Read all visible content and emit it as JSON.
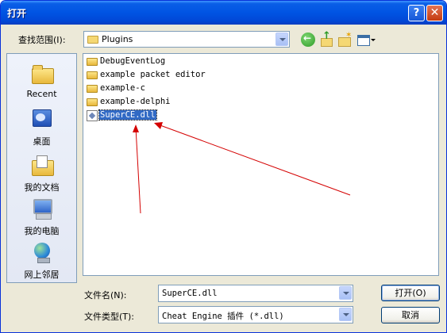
{
  "window": {
    "title": "打开"
  },
  "titlebar": {
    "help_glyph": "?",
    "close_glyph": "✕"
  },
  "lookin": {
    "label": "查找范围(I):",
    "value": "Plugins"
  },
  "toolbar": {
    "icons": [
      "back-icon",
      "up-folder-icon",
      "new-folder-icon",
      "views-menu-icon"
    ]
  },
  "places": [
    {
      "label": "Recent",
      "icon": "recent-folder-icon"
    },
    {
      "label": "桌面",
      "icon": "desktop-icon"
    },
    {
      "label": "我的文档",
      "icon": "my-documents-icon"
    },
    {
      "label": "我的电脑",
      "icon": "my-computer-icon"
    },
    {
      "label": "网上邻居",
      "icon": "network-icon"
    }
  ],
  "files": [
    {
      "name": "DebugEventLog",
      "type": "folder"
    },
    {
      "name": "example packet editor",
      "type": "folder"
    },
    {
      "name": "example-c",
      "type": "folder"
    },
    {
      "name": "example-delphi",
      "type": "folder"
    },
    {
      "name": "SuperCE.dll",
      "type": "dll",
      "selected": true
    }
  ],
  "filename": {
    "label": "文件名(N):",
    "value": "SuperCE.dll"
  },
  "filetype": {
    "label": "文件类型(T):",
    "value": "Cheat Engine 插件 (*.dll)"
  },
  "buttons": {
    "open": "打开(O)",
    "cancel": "取消"
  },
  "colors": {
    "titlebar": "#0054e3",
    "selection": "#316ac5",
    "annotation_arrow": "#d40000"
  }
}
